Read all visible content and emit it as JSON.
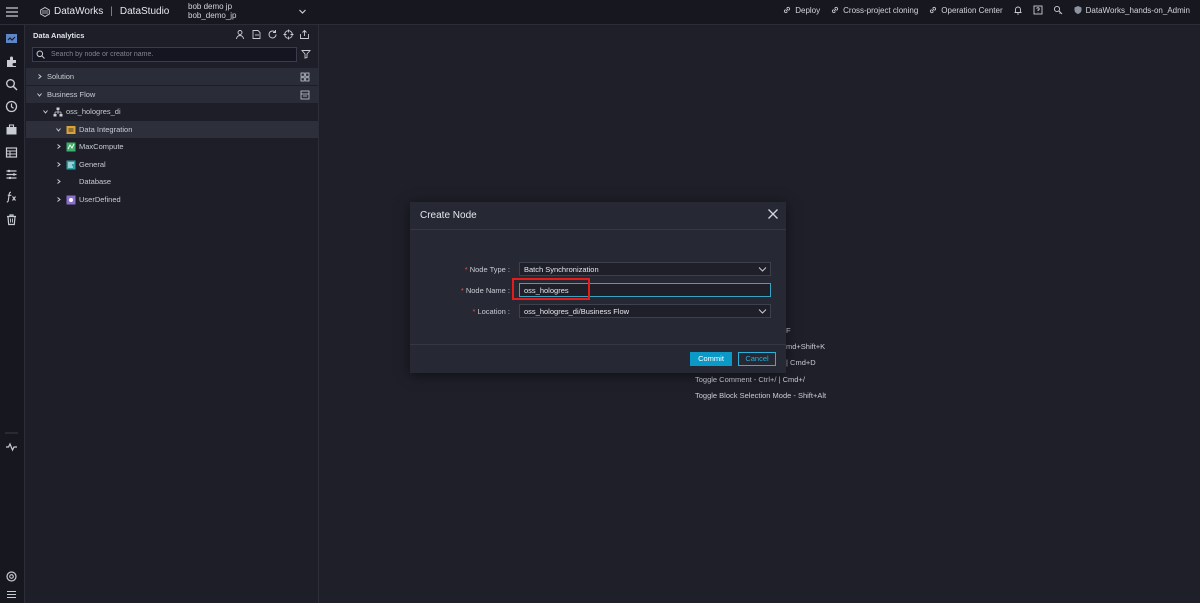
{
  "topbar": {
    "brand": "DataWorks",
    "separator": "|",
    "module": "DataStudio",
    "workspace_line1": "bob demo jp",
    "workspace_line2": "bob_demo_jp",
    "deploy": "Deploy",
    "cross_project": "Cross-project cloning",
    "operation_center": "Operation Center",
    "user": "DataWorks_hands-on_Admin"
  },
  "panel": {
    "title": "Data Analytics",
    "search_placeholder": "Search by node or creator name."
  },
  "tree": {
    "solution": "Solution",
    "business_flow": "Business Flow",
    "workflow": "oss_hologres_di",
    "children": [
      "Data Integration",
      "MaxCompute",
      "General",
      "Database",
      "UserDefined"
    ]
  },
  "shortcuts": {
    "s1": "F",
    "s2": "md+Shift+K",
    "s3": "| Cmd+D",
    "s4": "Toggle Comment - Ctrl+/ | Cmd+/",
    "s5": "Toggle Block Selection Mode - Shift+Alt"
  },
  "modal": {
    "title": "Create Node",
    "required_mark": "*",
    "node_type_label": "Node Type :",
    "node_type_value": "Batch Synchronization",
    "node_name_label": "Node Name :",
    "node_name_value": "oss_hologres",
    "location_label": "Location :",
    "location_value": "oss_hologres_di/Business Flow",
    "commit": "Commit",
    "cancel": "Cancel"
  },
  "colors": {
    "accent": "#0b9ac7",
    "highlight": "#e31c1c",
    "required": "#e05252"
  }
}
